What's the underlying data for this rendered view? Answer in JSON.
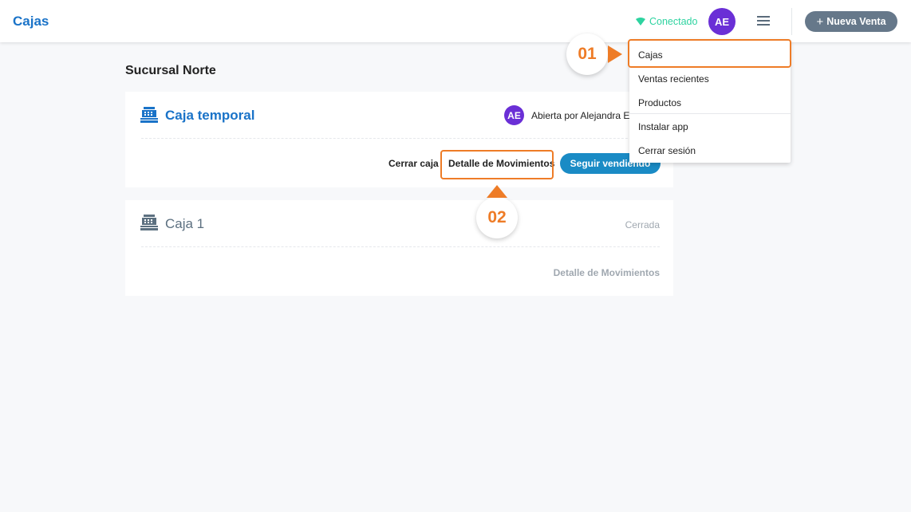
{
  "header": {
    "title": "Cajas",
    "status": "Conectado",
    "status_icon": "wifi-icon",
    "avatar_initials": "AE",
    "menu_icon": "hamburger-icon",
    "new_sale_plus": "+",
    "new_sale_label": "Nueva Venta"
  },
  "colors": {
    "primary": "#1a73c8",
    "accent_button": "#1a8bc5",
    "status_green": "#2ed3a0",
    "avatar_purple": "#6a2fd6",
    "new_sale_bg": "#66788a",
    "highlight_orange": "#ee7c27"
  },
  "main": {
    "branch": "Sucursal Norte",
    "registers": [
      {
        "name": "Caja temporal",
        "icon": "cash-register-icon",
        "avatar_initials": "AE",
        "status": "Abierta por Alejandra Er",
        "actions": {
          "close": "Cerrar caja",
          "movements": "Detalle de Movimientos",
          "keep_selling": "Seguir vendiendo"
        }
      },
      {
        "name": "Caja 1",
        "icon": "cash-register-icon",
        "status": "Cerrada",
        "actions": {
          "movements": "Detalle de Movimientos"
        }
      }
    ]
  },
  "dropdown": {
    "items": [
      "Cajas",
      "Ventas recientes",
      "Productos",
      "Instalar app",
      "Cerrar sesión"
    ]
  },
  "callouts": {
    "first": "01",
    "second": "02"
  }
}
